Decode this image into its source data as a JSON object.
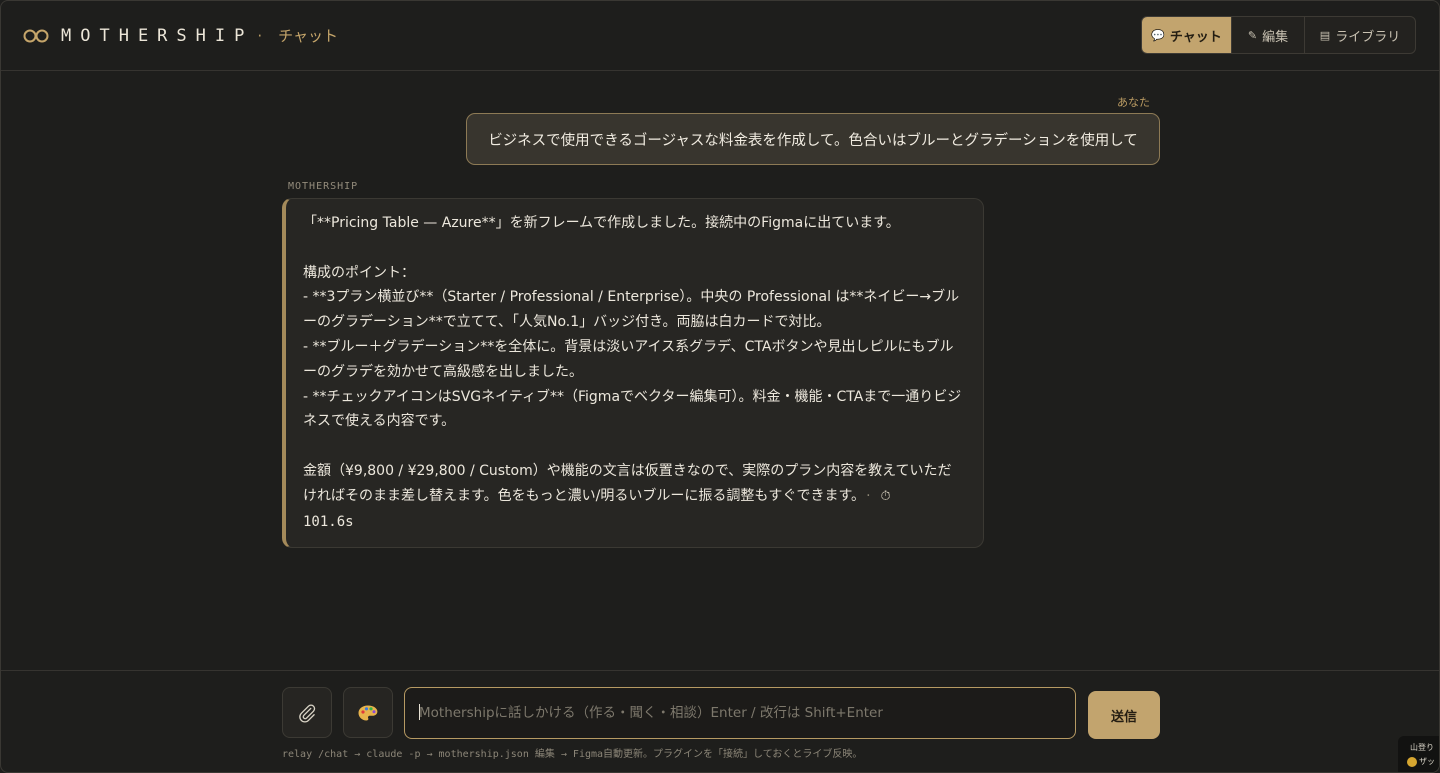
{
  "header": {
    "brand_name": "MOTHERSHIP",
    "separator": "·",
    "page_name": "チャット",
    "tabs": [
      {
        "icon": "💬",
        "label": "チャット",
        "active": true
      },
      {
        "icon": "✎",
        "label": "編集",
        "active": false
      },
      {
        "icon": "▤",
        "label": "ライブラリ",
        "active": false
      }
    ]
  },
  "conversation": {
    "user_label": "あなた",
    "user_message": "ビジネスで使用できるゴージャスな料金表を作成して。色合いはブルーとグラデーションを使用して",
    "assistant_label": "MOTHERSHIP",
    "assistant_message": "「**Pricing Table — Azure**」を新フレームで作成しました。接続中のFigmaに出ています。\n\n構成のポイント：\n- **3プラン横並び**（Starter / Professional / Enterprise）。中央の Professional は**ネイビー→ブルーのグラデーション**で立てて、「人気No.1」バッジ付き。両脇は白カードで対比。\n- **ブルー＋グラデーション**を全体に。背景は淡いアイス系グラデ、CTAボタンや見出しピルにもブルーのグラデを効かせて高級感を出しました。\n- **チェックアイコンはSVGネイティブ**（Figmaでベクター編集可）。料金・機能・CTAまで一通りビジネスで使える内容です。\n\n金額（¥9,800 / ¥29,800 / Custom）や機能の文言は仮置きなので、実際のプラン内容を教えていただければそのまま差し替えます。色をもっと濃い/明るいブルーに振る調整もすぐできます。",
    "meta_separator": "·",
    "elapsed": "101.6s"
  },
  "composer": {
    "placeholder": "Mothershipに話しかける（作る・聞く・相談）Enter / 改行は Shift+Enter",
    "value": "",
    "send_label": "送信",
    "hint": "relay /chat → claude -p → mothership.json 編集 → Figma自動更新。プラグインを「接続」しておくとライブ反映。"
  },
  "corner_widget": {
    "line1": "山登り",
    "line2": "ザッ"
  },
  "colors": {
    "background": "#1e1e1c",
    "accent": "#c2a46e",
    "user_bubble": "#38352e",
    "assistant_bubble": "#272623"
  }
}
